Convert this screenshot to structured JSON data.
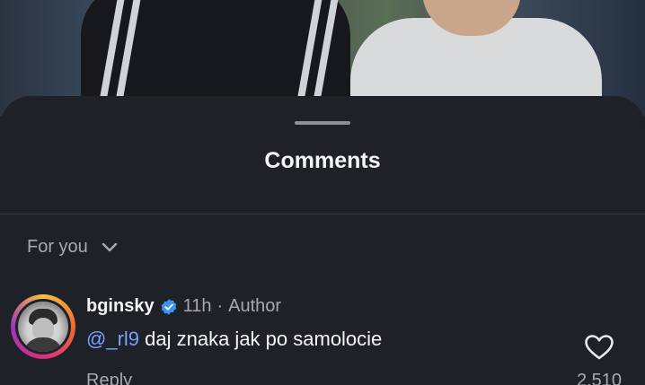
{
  "sheet": {
    "title": "Comments"
  },
  "sort": {
    "label": "For you"
  },
  "comment": {
    "username": "bginsky",
    "time": "11h",
    "separator": "·",
    "role": "Author",
    "mention": "@_rl9",
    "text": " daj znaka jak po samolocie",
    "reply_label": "Reply",
    "like_count": "2,510"
  },
  "icons": {
    "verified": "verified-badge-icon",
    "like": "heart-outline-icon",
    "sort": "chevron-down-icon"
  },
  "colors": {
    "background": "#1f2128",
    "mention": "#7c9eff",
    "verified": "#3797f0",
    "muted": "#a7a9ae"
  }
}
